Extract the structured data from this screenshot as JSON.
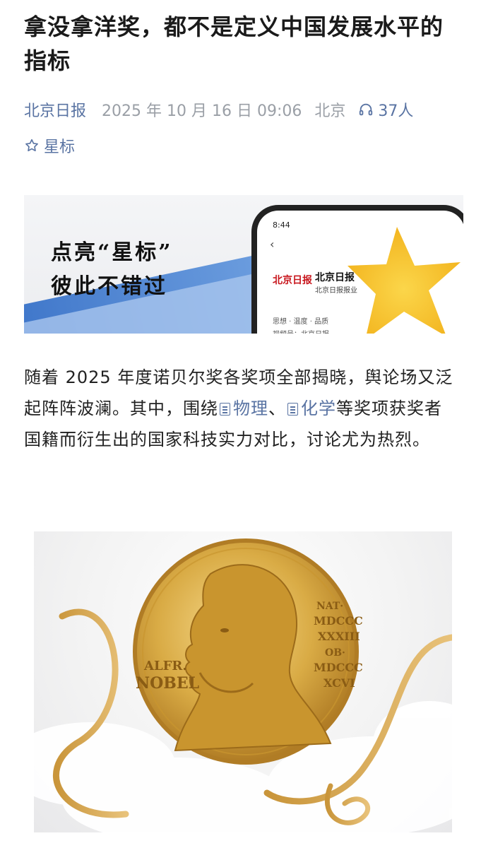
{
  "article": {
    "title": "拿没拿洋奖，都不是定义中国发展水平的指标",
    "source": "北京日报",
    "datetime": "2025 年 10 月 16 日 09:06",
    "location": "北京",
    "listeners": "37人",
    "star_label": "星标"
  },
  "banner": {
    "slogan_line1": "点亮“星标”",
    "slogan_line2": "彼此不错过",
    "phone": {
      "time": "8:44",
      "logo": "北京日报",
      "account_name": "北京日报",
      "account_sub": "北京日报报业",
      "tags": "思想 · 温度 · 品质",
      "video_id": "视频号：北京日报"
    }
  },
  "body": {
    "p1_part1": "随着 2025 年度诺贝尔奖各奖项全部揭晓，舆论场又泛起阵阵波澜。其中，围绕",
    "link1": "物理",
    "p1_sep": "、",
    "link2": "化学",
    "p1_part2": "等奖项获奖者国籍而衍生出的国家科技实力对比，讨论尤为热烈。"
  },
  "medal": {
    "text_left_1": "ALFR.",
    "text_left_2": "NOBEL",
    "text_right_1": "NAT·",
    "text_right_2": "MDCCC",
    "text_right_3": "XXXIII",
    "text_right_4": "OB·",
    "text_right_5": "MDCCC",
    "text_right_6": "XCVI"
  },
  "colors": {
    "link": "#5a74a3",
    "meta_gray": "#9a9fa6",
    "gold": "#d4a63a"
  }
}
